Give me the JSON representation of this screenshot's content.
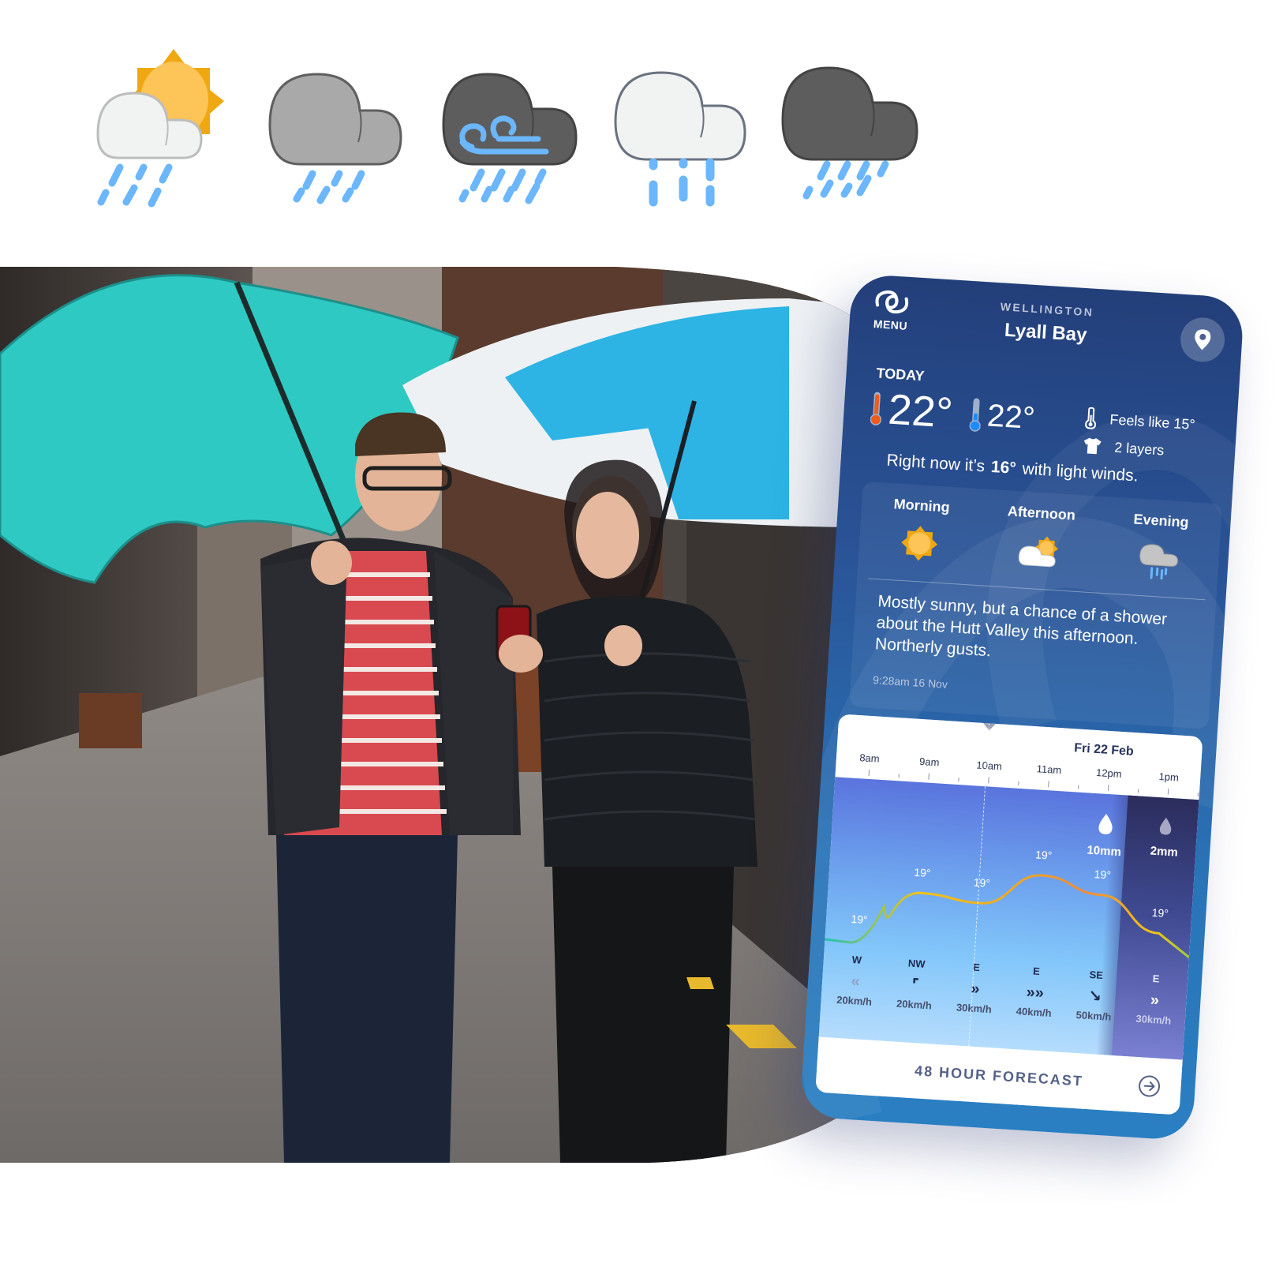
{
  "icons_row": [
    {
      "name": "partly-sunny-rain-icon"
    },
    {
      "name": "cloudy-rain-icon"
    },
    {
      "name": "windy-rain-icon"
    },
    {
      "name": "light-rain-icon"
    },
    {
      "name": "heavy-rain-icon"
    }
  ],
  "photo": {
    "alt": "Two people walking under umbrellas checking a phone"
  },
  "app": {
    "menu_label": "MENU",
    "region": "WELLINGTON",
    "place": "Lyall Bay",
    "today_label": "TODAY",
    "high_temp": "22°",
    "low_temp": "22°",
    "feels_like": "Feels like 15°",
    "layers": "2 layers",
    "now_prefix": "Right now it’s",
    "now_temp": "16°",
    "now_suffix": "with light winds.",
    "periods": [
      {
        "label": "Morning",
        "icon": "sun-icon"
      },
      {
        "label": "Afternoon",
        "icon": "partly-cloudy-icon"
      },
      {
        "label": "Evening",
        "icon": "cloud-rain-icon"
      }
    ],
    "summary": "Mostly sunny, but a chance of a shower about the Hutt Valley this afternoon. Northerly gusts.",
    "issued": "9:28am 16 Nov",
    "timeline": {
      "date": "Fri 22 Feb",
      "hours": [
        "8am",
        "9am",
        "10am",
        "11am",
        "12pm",
        "1pm"
      ],
      "rain": [
        {
          "amount": "10mm",
          "hour_index": 4
        },
        {
          "amount": "2mm",
          "hour_index": 5
        }
      ],
      "temps": [
        "19°",
        "19°",
        "19°",
        "19°",
        "19°",
        "19°"
      ],
      "wind": [
        {
          "dir": "W",
          "speed": "20km/h",
          "arrow": "«"
        },
        {
          "dir": "NW",
          "speed": "20km/h",
          "arrow": "⌜"
        },
        {
          "dir": "E",
          "speed": "30km/h",
          "arrow": "»"
        },
        {
          "dir": "E",
          "speed": "40km/h",
          "arrow": "»»"
        },
        {
          "dir": "SE",
          "speed": "50km/h",
          "arrow": "↘"
        },
        {
          "dir": "E",
          "speed": "30km/h",
          "arrow": "»"
        }
      ]
    },
    "forecast_button": "48 HOUR FORECAST"
  },
  "colors": {
    "rain_blue": "#6cb6fb",
    "sun_orange": "#f0a812",
    "sun_yellow": "#fdc457",
    "app_navy": "#233f7a",
    "app_blue": "#2a7fc2"
  }
}
